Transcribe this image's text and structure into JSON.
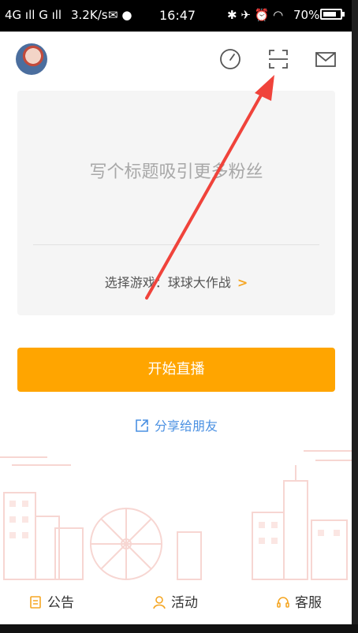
{
  "status_bar": {
    "network": "4G ıll  G ıll",
    "speed": "3.2K/s",
    "time": "16:47",
    "battery": "70%"
  },
  "header": {
    "icons": [
      "speedometer-icon",
      "scan-icon",
      "mail-icon"
    ]
  },
  "card": {
    "title_placeholder": "写个标题吸引更多粉丝",
    "game_label": "选择游戏：",
    "game_value": "球球大作战",
    "chevron": ">"
  },
  "start_button": "开始直播",
  "share_label": "分享给朋友",
  "tabs": [
    {
      "label": "公告",
      "icon": "notice-icon"
    },
    {
      "label": "活动",
      "icon": "person-icon"
    },
    {
      "label": "客服",
      "icon": "headset-icon"
    }
  ],
  "colors": {
    "accent": "#ffa500",
    "link": "#4a90e2",
    "annotation_arrow": "#f0433b"
  }
}
